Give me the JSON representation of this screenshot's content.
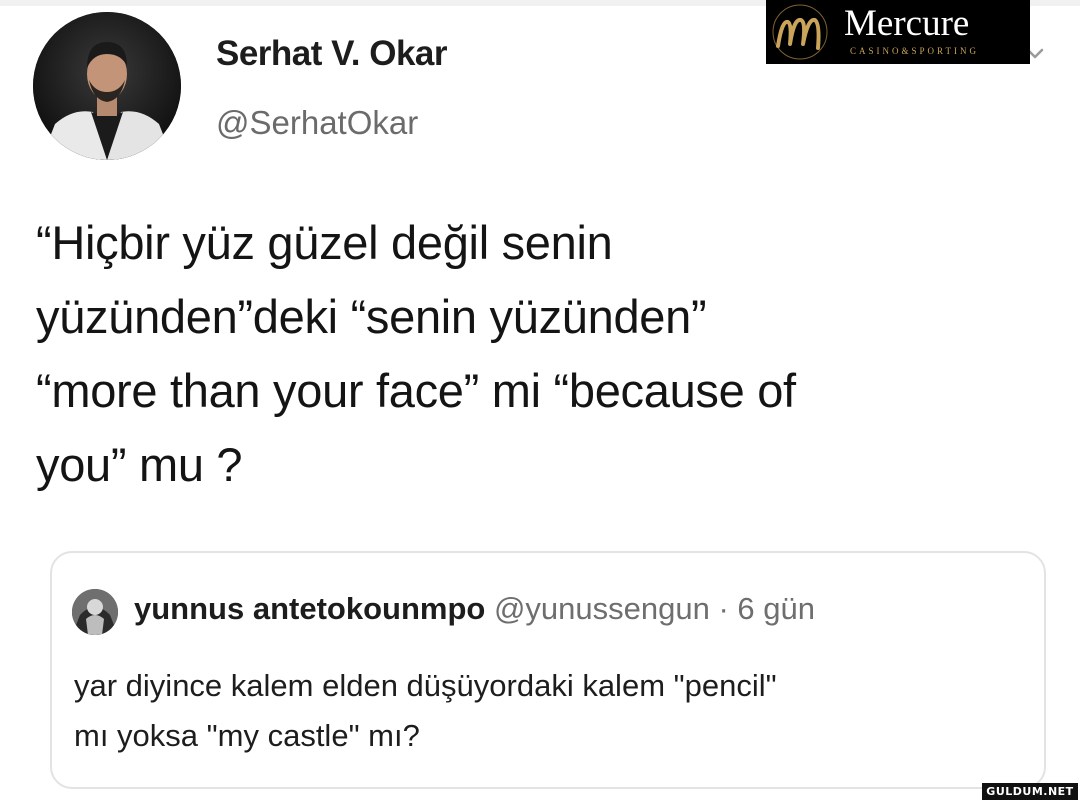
{
  "tweet": {
    "display_name": "Serhat V. Okar",
    "username": "@SerhatOkar",
    "text_lines": [
      "“Hiçbir yüz güzel değil senin",
      "yüzünden”deki “senin yüzünden”",
      "“more than your face” mi “because of",
      "you” mu ?"
    ]
  },
  "quoted_tweet": {
    "display_name": "yunnus antetokounmpo",
    "meta": "@yunussengun · 6 gün",
    "text_lines": [
      "yar diyince kalem elden düşüyordaki kalem \"pencil\"",
      "mı yoksa \"my castle\" mı?"
    ]
  },
  "logo": {
    "brand": "Mercure",
    "tagline": "CASINO&SPORTING"
  },
  "watermark": {
    "text": "GULDUM.NET"
  },
  "icons": {
    "more": "chevron-down-icon"
  },
  "colors": {
    "text": "#1d1d1d",
    "secondary_text": "#6b6b6b",
    "card_border": "#e3e3e3",
    "logo_background": "#000000",
    "logo_gold": "#c9a45a"
  }
}
